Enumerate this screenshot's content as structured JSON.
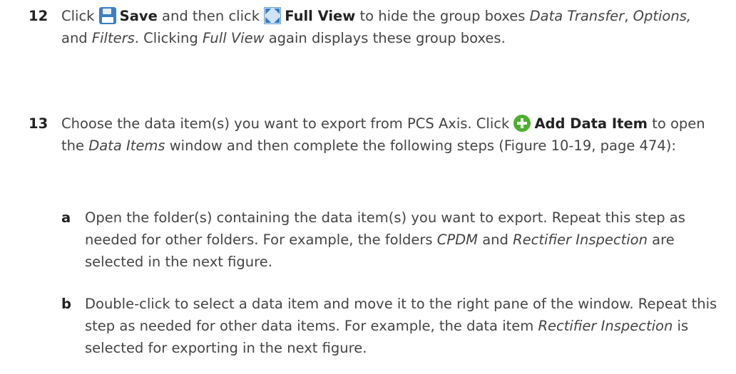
{
  "step12": {
    "number": "12",
    "click1": "Click",
    "save_icon": "floppy-disk-icon",
    "save_label": "Save",
    "then_click": "and then click",
    "full_icon": "full-view-icon",
    "full_view_label": "Full View",
    "text_a": "to hide the group boxes",
    "data_transfer": "Data Transfer",
    "comma1": ",",
    "options": "Options,",
    "and": "and",
    "filters": "Filters",
    "text_b": ". Clicking",
    "full_view_italic": "Full View",
    "text_c": "again displays these group boxes."
  },
  "step13": {
    "number": "13",
    "text_a": "Choose the data item(s) you want to export from PCS Axis. Click",
    "add_icon": "add-plus-icon",
    "add_label": "Add Data Item",
    "text_b": "to open the",
    "data_items": "Data Items",
    "text_c": "window and then complete the following steps (Figure 10-19, page 474):"
  },
  "sub_a": {
    "letter": "a",
    "text_a": "Open the folder(s) containing the data item(s) you want to export. Repeat this step as needed for other folders. For example, the folders",
    "cpdm": "CPDM",
    "and": "and",
    "rect_insp": "Rectifier Inspection",
    "text_b": "are selected in the next figure."
  },
  "sub_b": {
    "letter": "b",
    "text_a": "Double-click to select a data item and move it to the right pane of the window. Repeat this step as needed for other data items. For example, the data item",
    "rect_insp": "Rectifier Inspection",
    "text_b": "is selected for exporting in the next figure."
  }
}
